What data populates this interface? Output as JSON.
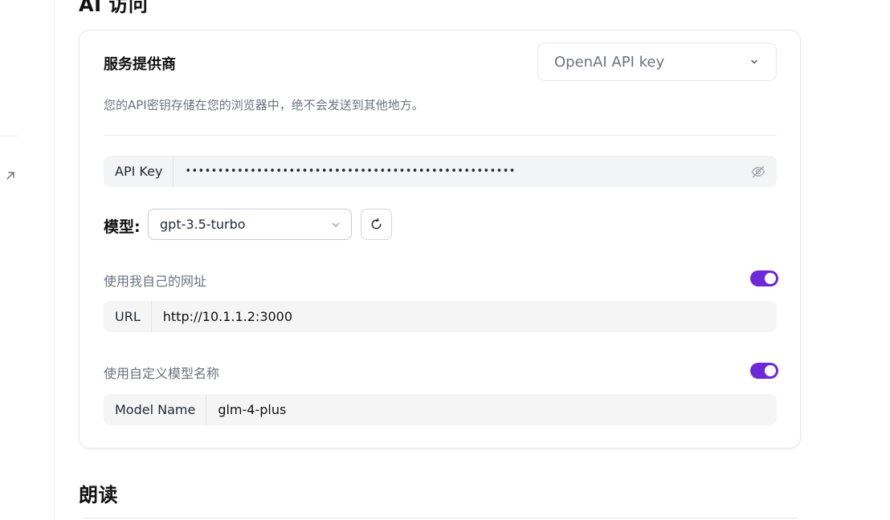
{
  "sections": {
    "ai_access_title": "AI 访问",
    "read_aloud_title": "朗读"
  },
  "provider": {
    "label": "服务提供商",
    "selected": "OpenAI API key",
    "description": "您的API密钥存储在您的浏览器中，绝不会发送到其他地方。"
  },
  "api_key": {
    "prefix": "API Key",
    "masked_value": "•••••••••••••••••••••••••••••••••••••••••••••••••••",
    "icon": "eye-off-icon"
  },
  "model": {
    "label": "模型:",
    "selected": "gpt-3.5-turbo",
    "refresh_icon": "refresh-icon"
  },
  "custom_url": {
    "toggle_label": "使用我自己的网址",
    "enabled": true,
    "prefix": "URL",
    "value": "http://10.1.1.2:3000"
  },
  "custom_model": {
    "toggle_label": "使用自定义模型名称",
    "enabled": true,
    "prefix": "Model Name",
    "value": "glm-4-plus"
  },
  "colors": {
    "accent": "#6d28d9",
    "muted_text": "#6b7280",
    "input_bg": "#f3f4f6"
  }
}
